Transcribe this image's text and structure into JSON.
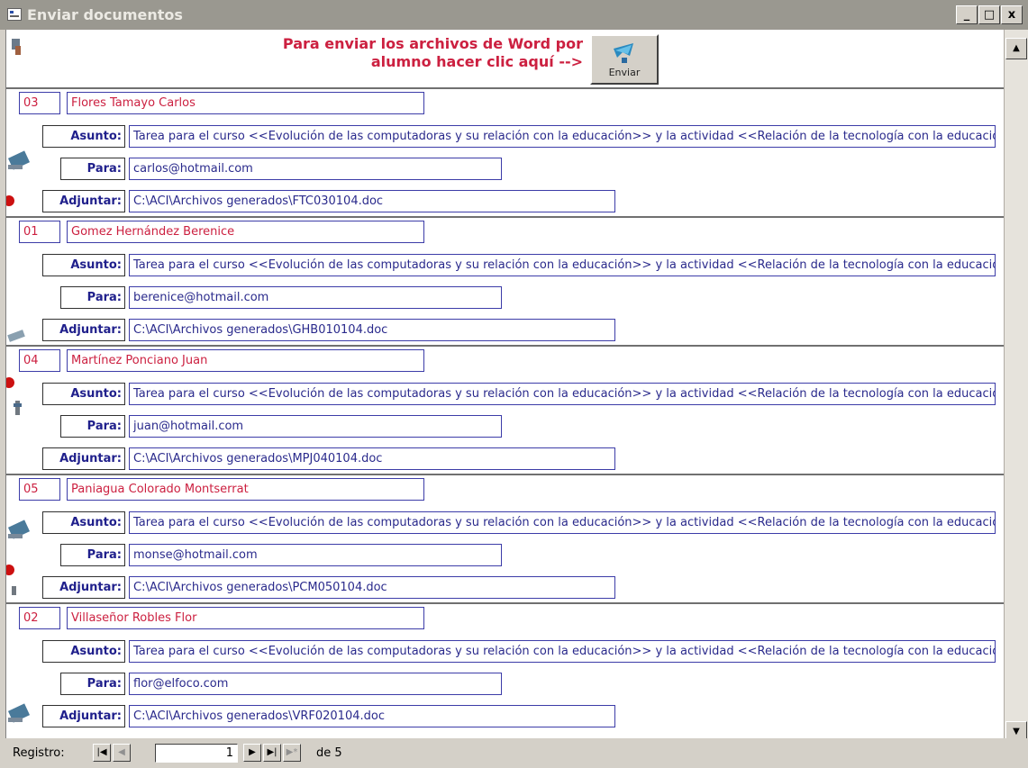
{
  "window": {
    "title": "Enviar documentos"
  },
  "title_buttons": {
    "minimize": "_",
    "maximize": "□",
    "close": "x"
  },
  "header": {
    "instruction_line1": "Para enviar los archivos de Word por",
    "instruction_line2": "alumno hacer clic aquí -->",
    "send_button_label": "Enviar"
  },
  "labels": {
    "asunto": "Asunto:",
    "para": "Para:",
    "adjuntar": "Adjuntar:"
  },
  "records": [
    {
      "num": "03",
      "name": "Flores Tamayo Carlos",
      "asunto": "Tarea para el curso <<Evolución de las computadoras y su relación con la educación>> y la actividad <<Relación de la tecnología con la educación>>",
      "para": "carlos@hotmail.com",
      "adjuntar": "C:\\ACI\\Archivos generados\\FTC030104.doc"
    },
    {
      "num": "01",
      "name": "Gomez Hernández Berenice",
      "asunto": "Tarea para el curso <<Evolución de las computadoras y su relación con la educación>> y la actividad <<Relación de la tecnología con la educación>>",
      "para": "berenice@hotmail.com",
      "adjuntar": "C:\\ACI\\Archivos generados\\GHB010104.doc"
    },
    {
      "num": "04",
      "name": "Martínez Ponciano Juan",
      "asunto": "Tarea para el curso <<Evolución de las computadoras y su relación con la educación>> y la actividad <<Relación de la tecnología con la educación>>",
      "para": "juan@hotmail.com",
      "adjuntar": "C:\\ACI\\Archivos generados\\MPJ040104.doc"
    },
    {
      "num": "05",
      "name": "Paniagua Colorado Montserrat",
      "asunto": "Tarea para el curso <<Evolución de las computadoras y su relación con la educación>> y la actividad <<Relación de la tecnología con la educación>>",
      "para": "monse@hotmail.com",
      "adjuntar": "C:\\ACI\\Archivos generados\\PCM050104.doc"
    },
    {
      "num": "02",
      "name": "Villaseñor Robles Flor",
      "asunto": "Tarea para el curso <<Evolución de las computadoras y su relación con la educación>> y la actividad <<Relación de la tecnología con la educación>>",
      "para": "flor@elfoco.com",
      "adjuntar": "C:\\ACI\\Archivos generados\\VRF020104.doc"
    }
  ],
  "navigation": {
    "label": "Registro:",
    "current": "1",
    "of_label": "de 5",
    "first_icon": "first-record-icon",
    "prev_icon": "previous-record-icon",
    "next_icon": "next-record-icon",
    "last_icon": "last-record-icon",
    "new_icon": "new-record-icon"
  },
  "scrollbar": {
    "up": "▲",
    "down": "▼"
  },
  "colors": {
    "field_text": "#cc2040",
    "label_text": "#20208c",
    "border": "#3c3ca8",
    "titlebar": "#9a9890"
  }
}
